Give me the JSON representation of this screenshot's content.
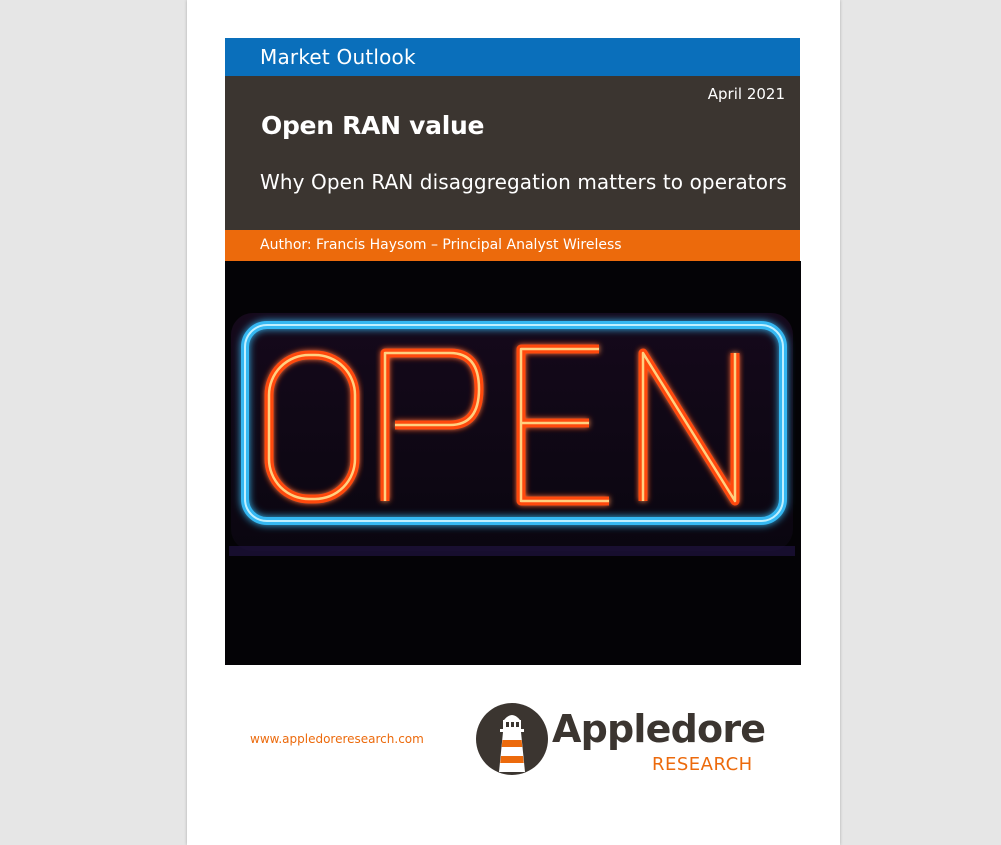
{
  "header": {
    "series_label": "Market Outlook",
    "date": "April 2021",
    "title": "Open RAN value",
    "subtitle": "Why Open RAN disaggregation matters to operators",
    "author_line": "Author:  Francis Haysom – Principal Analyst Wireless"
  },
  "photo": {
    "sign_text": "OPEN",
    "sign_outline_color": "#35b8f2",
    "sign_letter_color": "#ff5a1a"
  },
  "footer": {
    "website": "www.appledoreresearch.com",
    "logo_name": "Appledore",
    "logo_sub": "RESEARCH",
    "logo_icon": "lighthouse-icon"
  },
  "colors": {
    "blue_band": "#0a6fbb",
    "dark_band": "#3b3530",
    "orange": "#ec6a0c"
  }
}
